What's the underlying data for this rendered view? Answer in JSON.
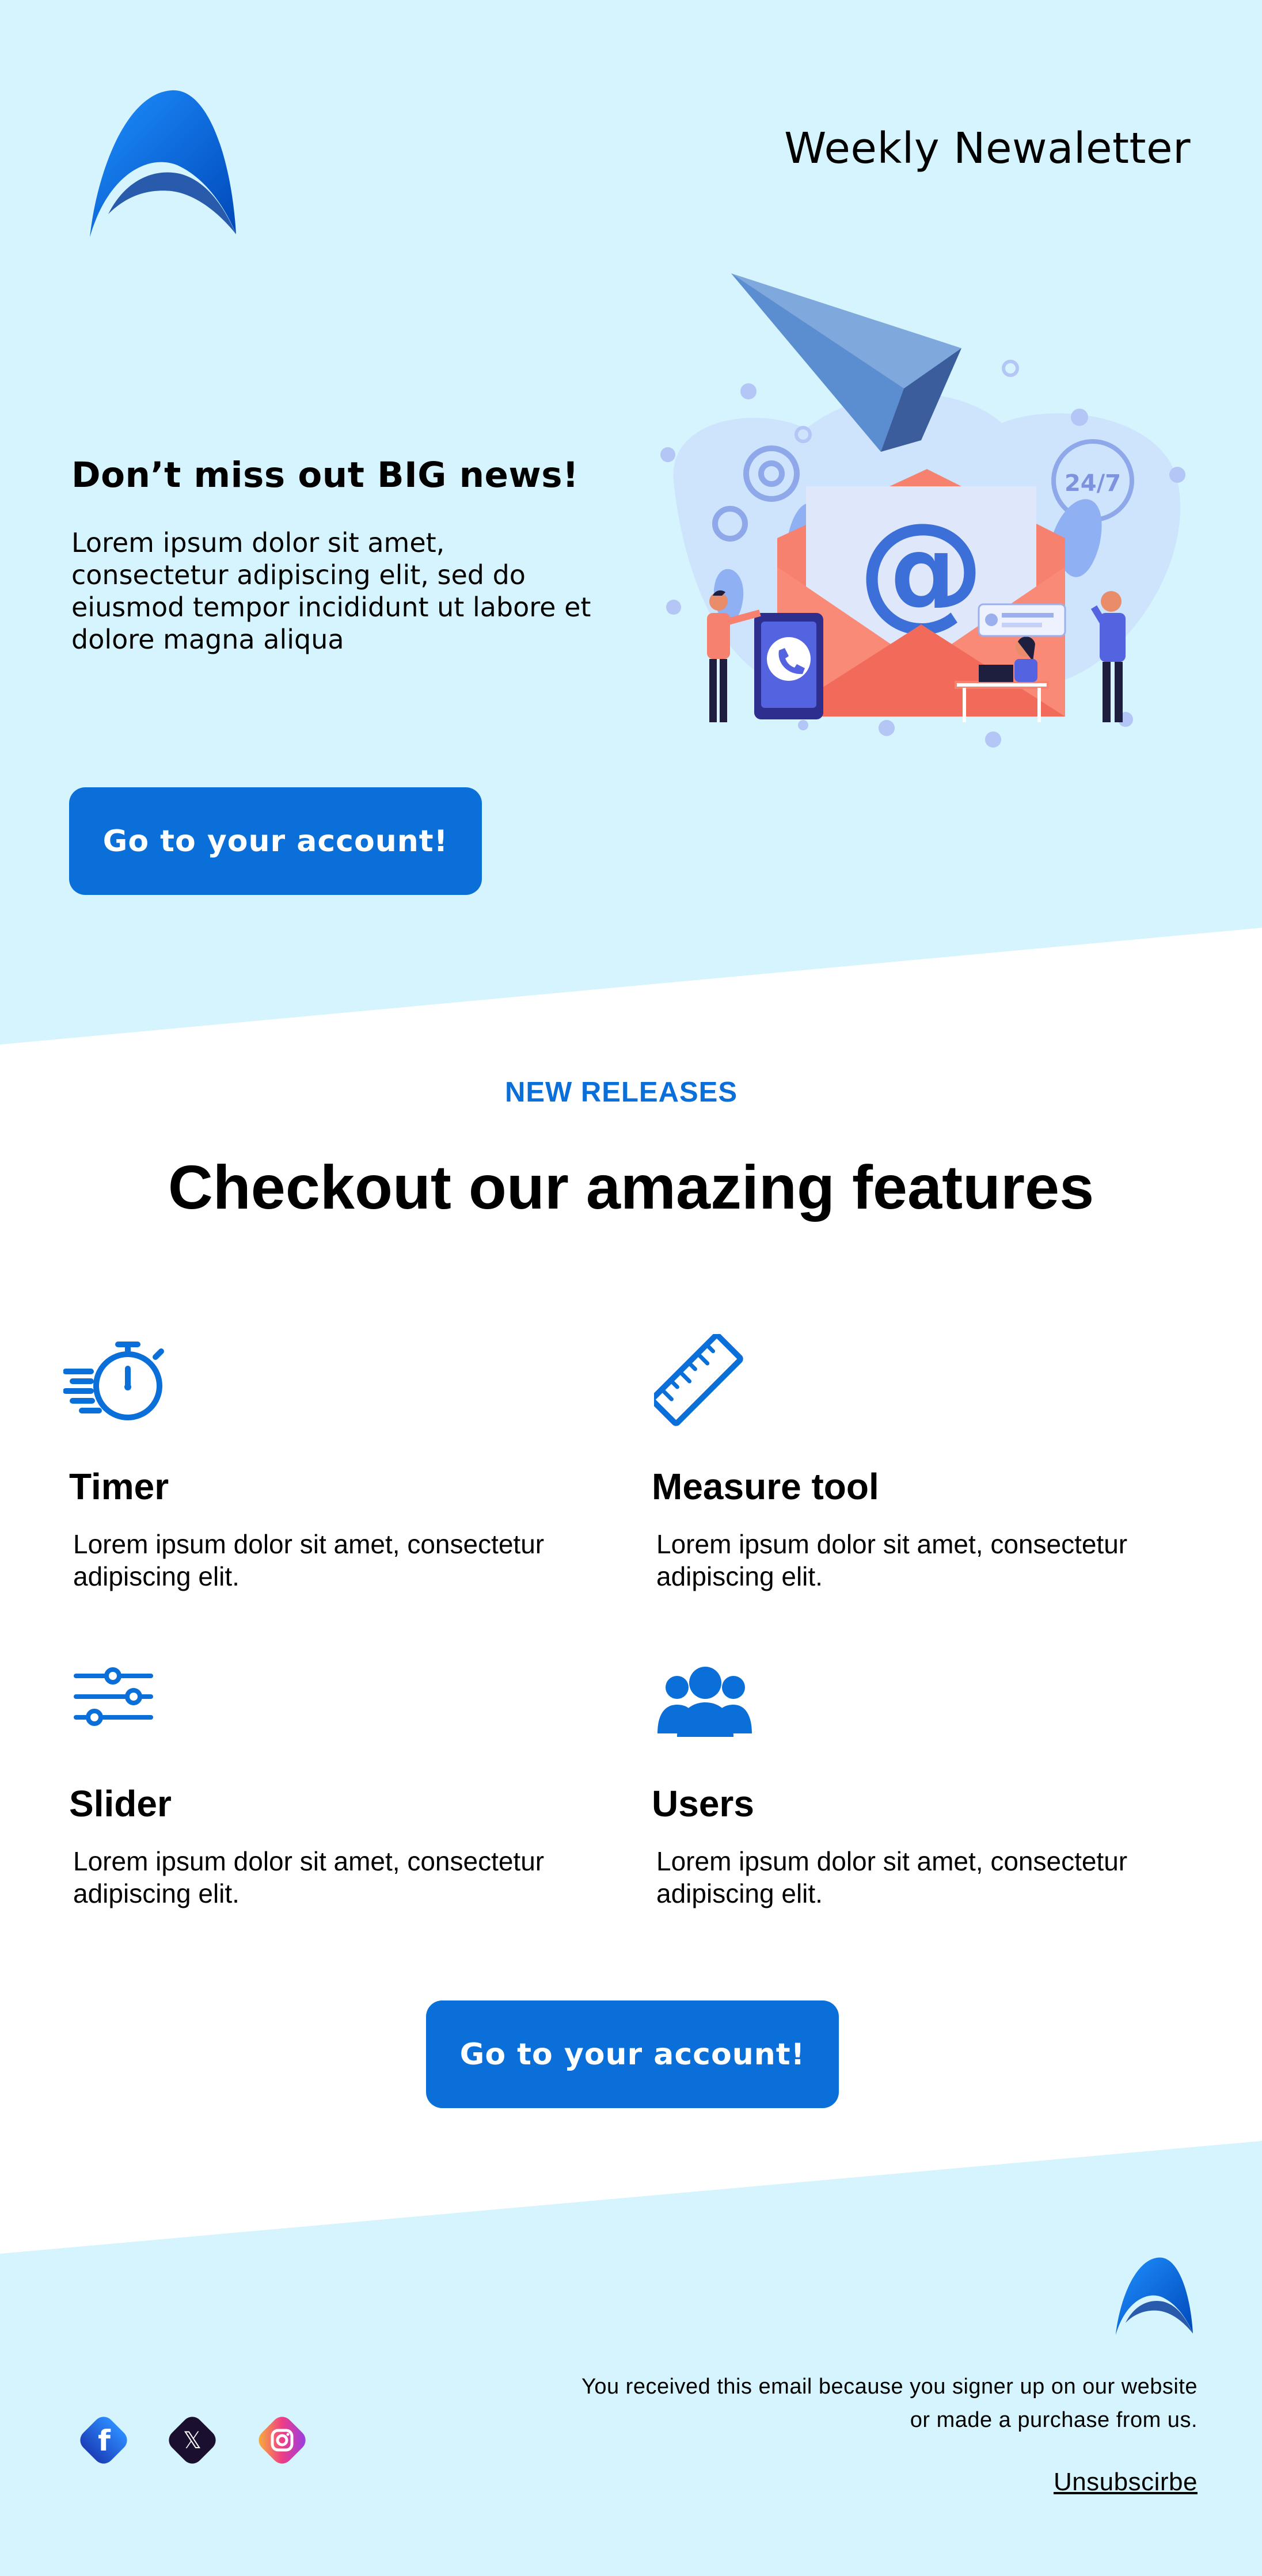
{
  "colors": {
    "light_bg": "#d5f4fe",
    "accent": "#0a6fd8",
    "text": "#000000"
  },
  "header": {
    "title": "Weekly Newaletter"
  },
  "hero": {
    "heading": "Don’t miss out BIG news!",
    "text": "Lorem ipsum dolor sit amet, consectetur adipiscing elit, sed do eiusmod tempor incididunt ut labore et dolore magna aliqua",
    "button_label": "Go to your account!",
    "illustration": {
      "at_symbol": "@",
      "badge": "24/7"
    }
  },
  "features": {
    "eyebrow": "NEW RELEASES",
    "heading": "Checkout our amazing features",
    "items": [
      {
        "icon": "stopwatch-icon",
        "title": "Timer",
        "description": "Lorem ipsum dolor sit amet, consectetur adipiscing elit."
      },
      {
        "icon": "ruler-icon",
        "title": "Measure tool",
        "description": "Lorem ipsum dolor sit amet, consectetur adipiscing elit."
      },
      {
        "icon": "sliders-icon",
        "title": "Slider",
        "description": "Lorem ipsum dolor sit amet, consectetur adipiscing elit."
      },
      {
        "icon": "users-icon",
        "title": "Users",
        "description": "Lorem ipsum dolor sit amet, consectetur adipiscing elit."
      }
    ],
    "button_label": "Go to your account!"
  },
  "footer": {
    "note": "You received this email because you signer up on our website or made a purchase from us.",
    "unsubscribe_label": "Unsubscirbe",
    "social": [
      {
        "icon": "facebook-icon",
        "glyph": "f"
      },
      {
        "icon": "x-icon",
        "glyph": "𝕏"
      },
      {
        "icon": "instagram-icon",
        "glyph": ""
      }
    ]
  }
}
